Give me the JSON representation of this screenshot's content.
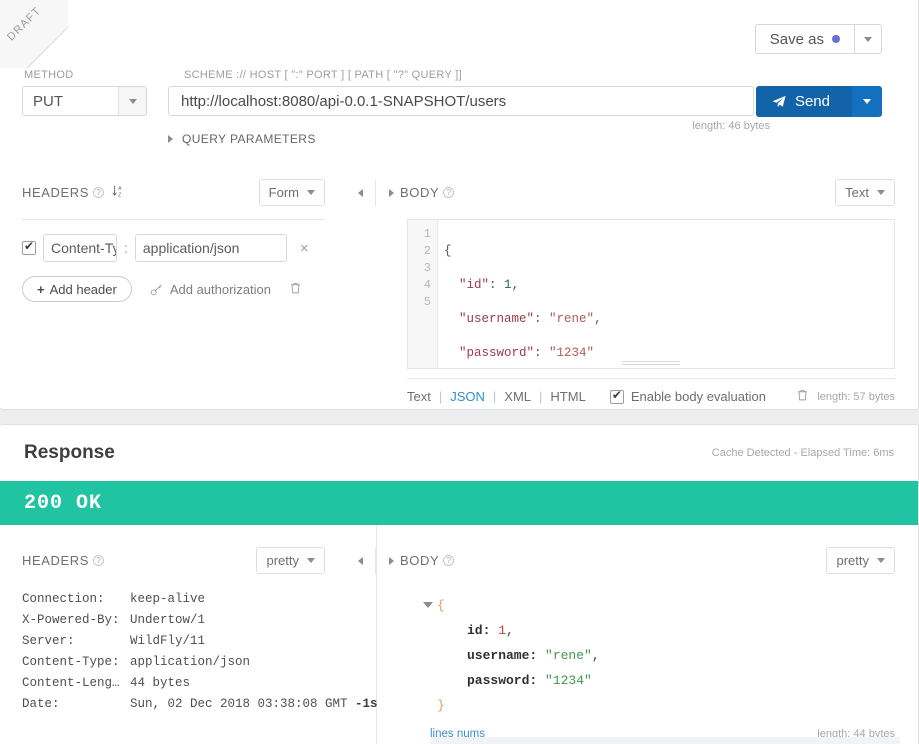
{
  "request": {
    "draft_badge": "DRAFT",
    "save_as_label": "Save as",
    "method_label": "METHOD",
    "method_value": "PUT",
    "url_label": "SCHEME :// HOST [ \":\" PORT ] [ PATH [ \"?\" QUERY ]]",
    "url_value": "http://localhost:8080/api-0.0.1-SNAPSHOT/users",
    "send_label": "Send",
    "url_length": "length: 46 bytes",
    "query_parameters_label": "QUERY PARAMETERS",
    "accent_blue": "#1263a8",
    "save_dot_color": "#6c6cdd",
    "headers": {
      "title": "HEADERS",
      "help_glyph": "?",
      "sort_glyph": "↓",
      "sort_sub": "A\nZ",
      "mode_value": "Form",
      "rows": [
        {
          "enabled": true,
          "name": "Content-Type",
          "value": "application/json",
          "remove": "×"
        }
      ],
      "add_header_label": "Add header",
      "add_header_plus": "+",
      "add_authorization_label": "Add authorization",
      "trash_glyph": "🗑"
    },
    "body": {
      "title": "BODY",
      "help_glyph": "?",
      "mode_value": "Text",
      "line_numbers": [
        "1",
        "2",
        "3",
        "4",
        "5"
      ],
      "lines": [
        {
          "punc_open": "{"
        },
        {
          "key": "\"id\"",
          "colon": ": ",
          "num": "1",
          "comma": ","
        },
        {
          "key": "\"username\"",
          "colon": ": ",
          "str": "\"rene\"",
          "comma": ","
        },
        {
          "key": "\"password\"",
          "colon": ": ",
          "str": "\"1234\"",
          "comma": ""
        },
        {
          "punc_close": "}"
        }
      ],
      "formats": [
        "Text",
        "JSON",
        "XML",
        "HTML"
      ],
      "active_format": "JSON",
      "enable_eval_label": "Enable body evaluation",
      "enable_eval_checked": true,
      "trash_glyph": "🗑",
      "length": "length: 57 bytes"
    }
  },
  "response": {
    "title": "Response",
    "meta": "Cache Detected - Elapsed Time: 6ms",
    "status_text": "200 OK",
    "status_color": "#20c3a2",
    "headers": {
      "title": "HEADERS",
      "help_glyph": "?",
      "mode_value": "pretty",
      "rows": [
        {
          "key": "Connection:",
          "value": "keep-alive"
        },
        {
          "key": "X-Powered-By:",
          "value": "Undertow/1"
        },
        {
          "key": "Server:",
          "value": "WildFly/11"
        },
        {
          "key": "Content-Type:",
          "value": "application/json"
        },
        {
          "key": "Content-Leng…",
          "value": "44 bytes"
        },
        {
          "key": "Date:",
          "value": "Sun, 02 Dec 2018 03:38:08 GMT ",
          "value_bold": "-1s"
        }
      ]
    },
    "body": {
      "title": "BODY",
      "help_glyph": "?",
      "mode_value": "pretty",
      "open_brace": "{",
      "close_brace": "}",
      "entries": [
        {
          "key": "id:",
          "num": "1",
          "comma": ","
        },
        {
          "key": "username:",
          "str": "\"rene\"",
          "comma": ","
        },
        {
          "key": "password:",
          "str": "\"1234\"",
          "comma": ""
        }
      ],
      "lines_nums_label": "lines nums",
      "length": "length: 44 bytes"
    }
  }
}
